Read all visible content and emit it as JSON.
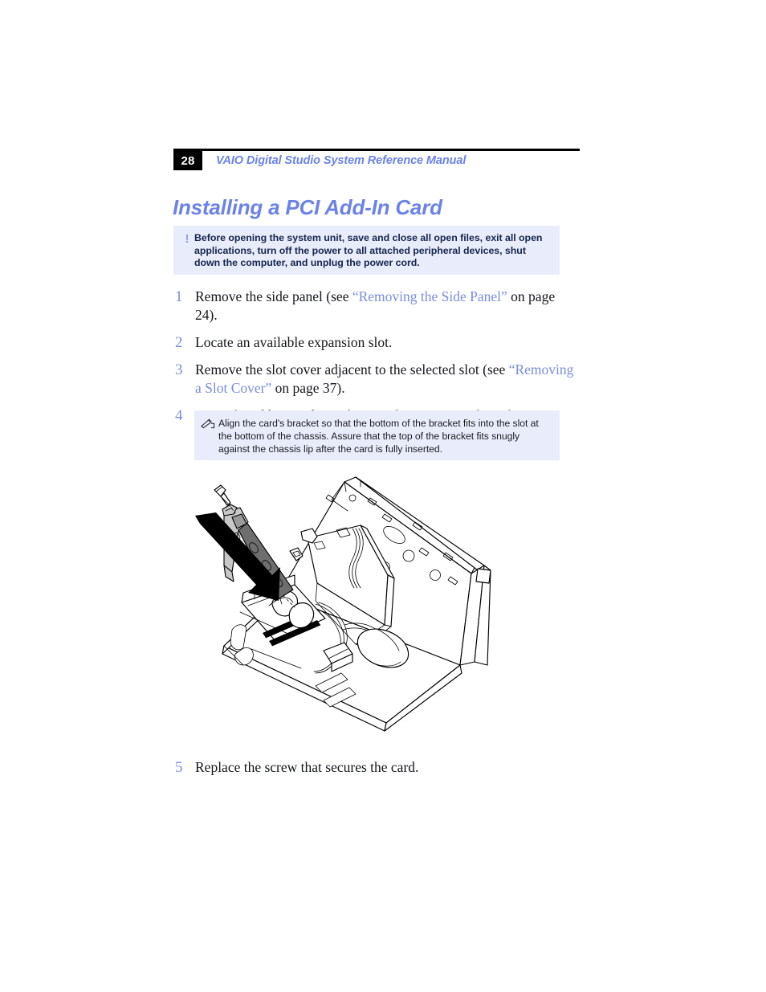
{
  "document": {
    "page_number": "28",
    "running_header": "VAIO Digital Studio System Reference Manual",
    "section_heading": "Installing a PCI Add-In Card"
  },
  "colors": {
    "accent_blue": "#6b83e8",
    "xref_blue": "#7b8ce0",
    "note_background": "#e9ecfb",
    "caution_text": "#16264f",
    "rule": "#000000"
  },
  "caution": {
    "icon": "exclamation-icon",
    "icon_glyph": "!",
    "text": "Before opening the system unit, save and close all open files, exit all open applications, turn off the power to all attached peripheral devices, shut down the computer, and unplug the power cord."
  },
  "steps": [
    {
      "number": "1",
      "text_before": "Remove the side panel (see ",
      "xref": "“Removing the Side Panel”",
      "text_after": " on page 24)."
    },
    {
      "number": "2",
      "text_before": "Locate an available expansion slot.",
      "xref": "",
      "text_after": ""
    },
    {
      "number": "3",
      "text_before": "Remove the slot cover adjacent to the selected slot (see ",
      "xref": "“Removing a Slot Cover”",
      "text_after": " on page 37)."
    },
    {
      "number": "4",
      "text_before": "Insert the add-in card into the PCI slot. Use a gentle rocking motion, pressing down until the card is fully seated.",
      "xref": "",
      "text_after": ""
    }
  ],
  "note": {
    "icon": "pencil-note-icon",
    "text": "Align the card's bracket so that the bottom of the bracket fits into the slot at the bottom of the chassis. Assure that the top of the bracket fits snugly against the chassis lip after the card is fully inserted."
  },
  "illustration": {
    "name": "pci-card-installation-diagram",
    "description": "Line drawing of an open VAIO desktop chassis viewed from above with a PCI add-in card and mounting screw being inserted into an expansion slot; a bold black arrow shows the insertion direction."
  },
  "final_step": {
    "number": "5",
    "text_before": "Replace the screw that secures the card.",
    "xref": "",
    "text_after": ""
  }
}
